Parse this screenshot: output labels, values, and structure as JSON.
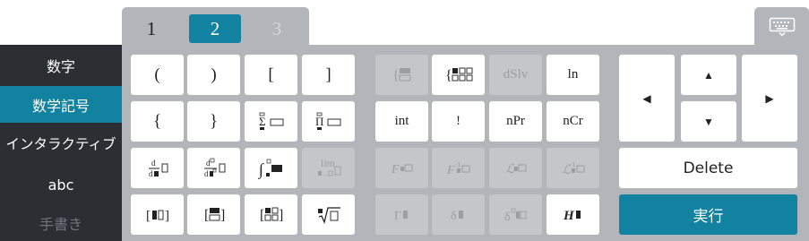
{
  "tabs": [
    {
      "label": "1",
      "state": "normal"
    },
    {
      "label": "2",
      "state": "active"
    },
    {
      "label": "3",
      "state": "disabled"
    }
  ],
  "keyboard_toggle_icon": "keyboard-icon",
  "sidebar": {
    "items": [
      {
        "label": "数字",
        "state": "normal"
      },
      {
        "label": "数学記号",
        "state": "active"
      },
      {
        "label": "インタラクティブ",
        "state": "normal"
      },
      {
        "label": "abc",
        "state": "normal"
      },
      {
        "label": "手書き",
        "state": "disabled"
      }
    ]
  },
  "keys": {
    "paren_open": "(",
    "paren_close": ")",
    "bracket_open": "[",
    "bracket_close": "]",
    "brace_open": "{",
    "brace_close": "}",
    "ln": "ln",
    "int": "int",
    "factorial": "!",
    "npr": "nPr",
    "ncr": "nCr",
    "dslv": "dSlv",
    "lim": "lim"
  },
  "icons": {
    "system_template": "piecewise-brace-icon",
    "system_matrix_template": "brace-matrix-icon",
    "sum": "sigma-icon",
    "product": "pi-product-icon",
    "derivative": "derivative-icon",
    "second_derivative": "second-derivative-icon",
    "integral": "definite-integral-icon",
    "limit": "limit-icon",
    "fourier": "fourier-transform-icon",
    "inverse_fourier": "inverse-fourier-icon",
    "laplace": "laplace-transform-icon",
    "inverse_laplace": "inverse-laplace-icon",
    "vector": "vector-icon",
    "matrix_col": "column-vector-icon",
    "matrix": "matrix-icon",
    "sqrt": "nth-root-icon",
    "gamma": "gamma-function-icon",
    "delta": "dirac-delta-icon",
    "delta_n": "delta-derivative-icon",
    "heaviside": "heaviside-icon"
  },
  "nav": {
    "left": "◀",
    "up": "▲",
    "right": "▶",
    "down": "▼",
    "delete": "Delete",
    "execute": "実行"
  },
  "colors": {
    "accent": "#11829f",
    "panel": "#b2b5ba",
    "sidebar": "#2b2e33",
    "key": "#ffffff",
    "key_disabled": "#c4c6ca"
  }
}
